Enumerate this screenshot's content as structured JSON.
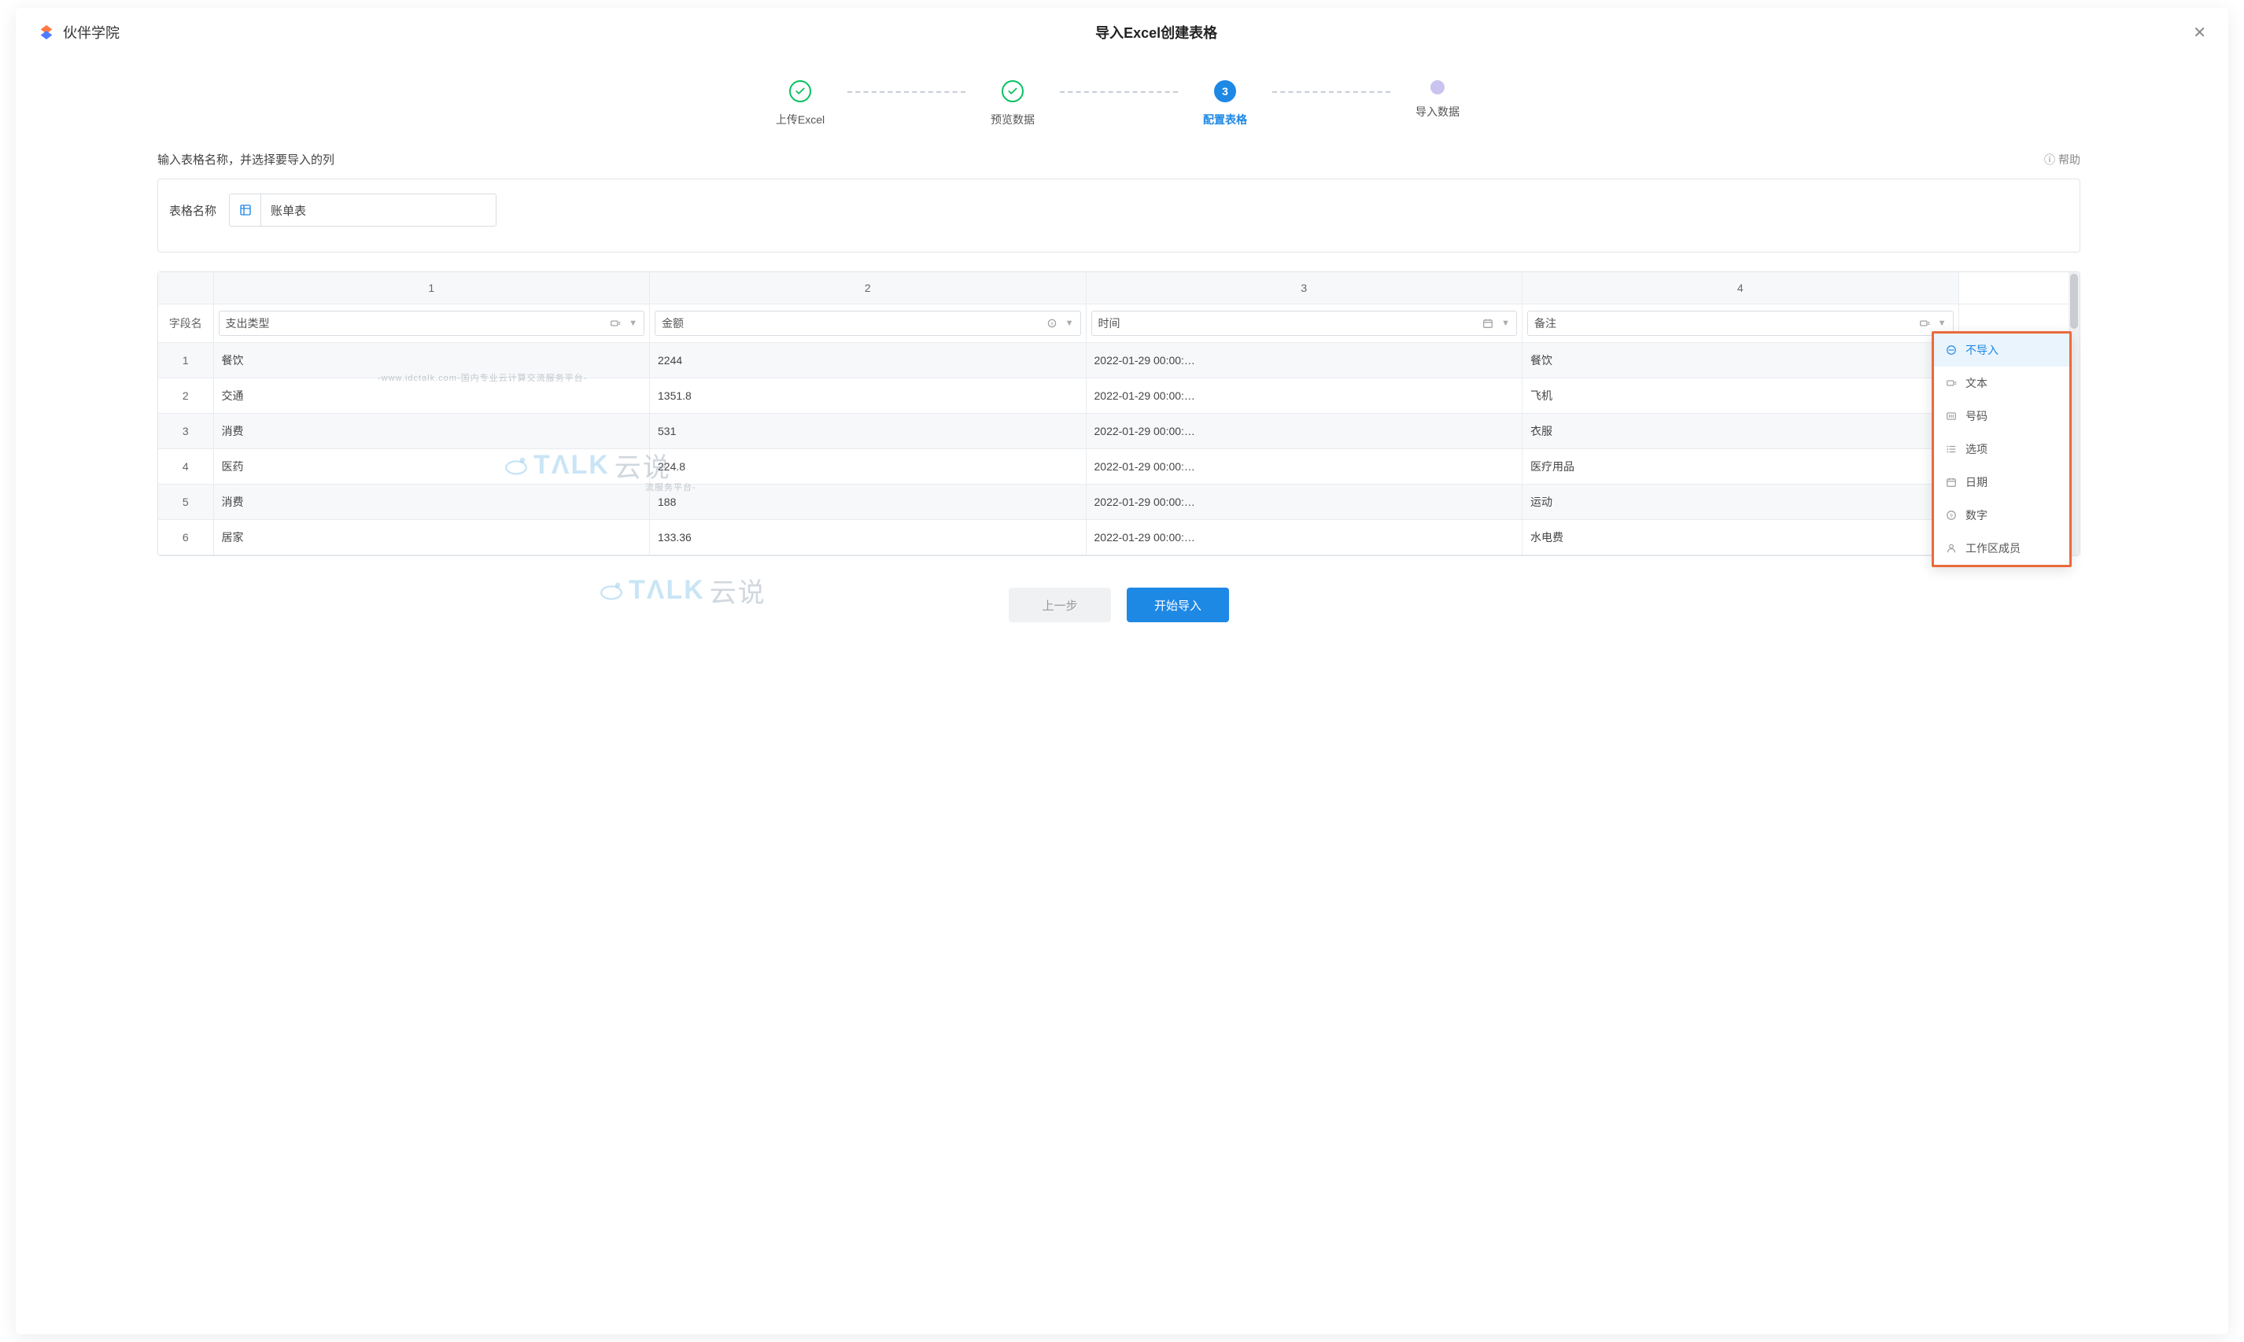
{
  "brand": {
    "name": "伙伴学院"
  },
  "modal": {
    "title": "导入Excel创建表格"
  },
  "stepper": {
    "steps": [
      "上传Excel",
      "预览数据",
      "配置表格",
      "导入数据"
    ],
    "active_index": 2,
    "active_number": "3"
  },
  "section": {
    "hint": "输入表格名称，并选择要导入的列",
    "help": "帮助"
  },
  "name_box": {
    "label": "表格名称",
    "value": "账单表"
  },
  "grid": {
    "field_header": "字段名",
    "col_nums": [
      "1",
      "2",
      "3",
      "4"
    ],
    "columns": [
      {
        "name": "支出类型",
        "type_icon": "text"
      },
      {
        "name": "金额",
        "type_icon": "number9"
      },
      {
        "name": "时间",
        "type_icon": "date"
      },
      {
        "name": "备注",
        "type_icon": "text"
      }
    ],
    "rows": [
      {
        "idx": "1",
        "cells": [
          "餐饮",
          "2244",
          "2022-01-29 00:00:…",
          "餐饮"
        ]
      },
      {
        "idx": "2",
        "cells": [
          "交通",
          "1351.8",
          "2022-01-29 00:00:…",
          "飞机"
        ]
      },
      {
        "idx": "3",
        "cells": [
          "消费",
          "531",
          "2022-01-29 00:00:…",
          "衣服"
        ]
      },
      {
        "idx": "4",
        "cells": [
          "医药",
          "224.8",
          "2022-01-29 00:00:…",
          "医疗用品"
        ]
      },
      {
        "idx": "5",
        "cells": [
          "消费",
          "188",
          "2022-01-29 00:00:…",
          "运动"
        ]
      },
      {
        "idx": "6",
        "cells": [
          "居家",
          "133.36",
          "2022-01-29 00:00:…",
          "水电费"
        ]
      }
    ]
  },
  "dropdown": {
    "options": [
      {
        "label": "不导入",
        "icon": "skip",
        "selected": true
      },
      {
        "label": "文本",
        "icon": "text"
      },
      {
        "label": "号码",
        "icon": "number"
      },
      {
        "label": "选项",
        "icon": "list"
      },
      {
        "label": "日期",
        "icon": "date"
      },
      {
        "label": "数字",
        "icon": "number9"
      },
      {
        "label": "工作区成员",
        "icon": "person"
      }
    ]
  },
  "footer": {
    "prev": "上一步",
    "start": "开始导入"
  },
  "watermark": {
    "brand": "TΛLK",
    "cn": "云说",
    "sub": "-www.idctalk.com-国内专业云计算交流服务平台-"
  }
}
